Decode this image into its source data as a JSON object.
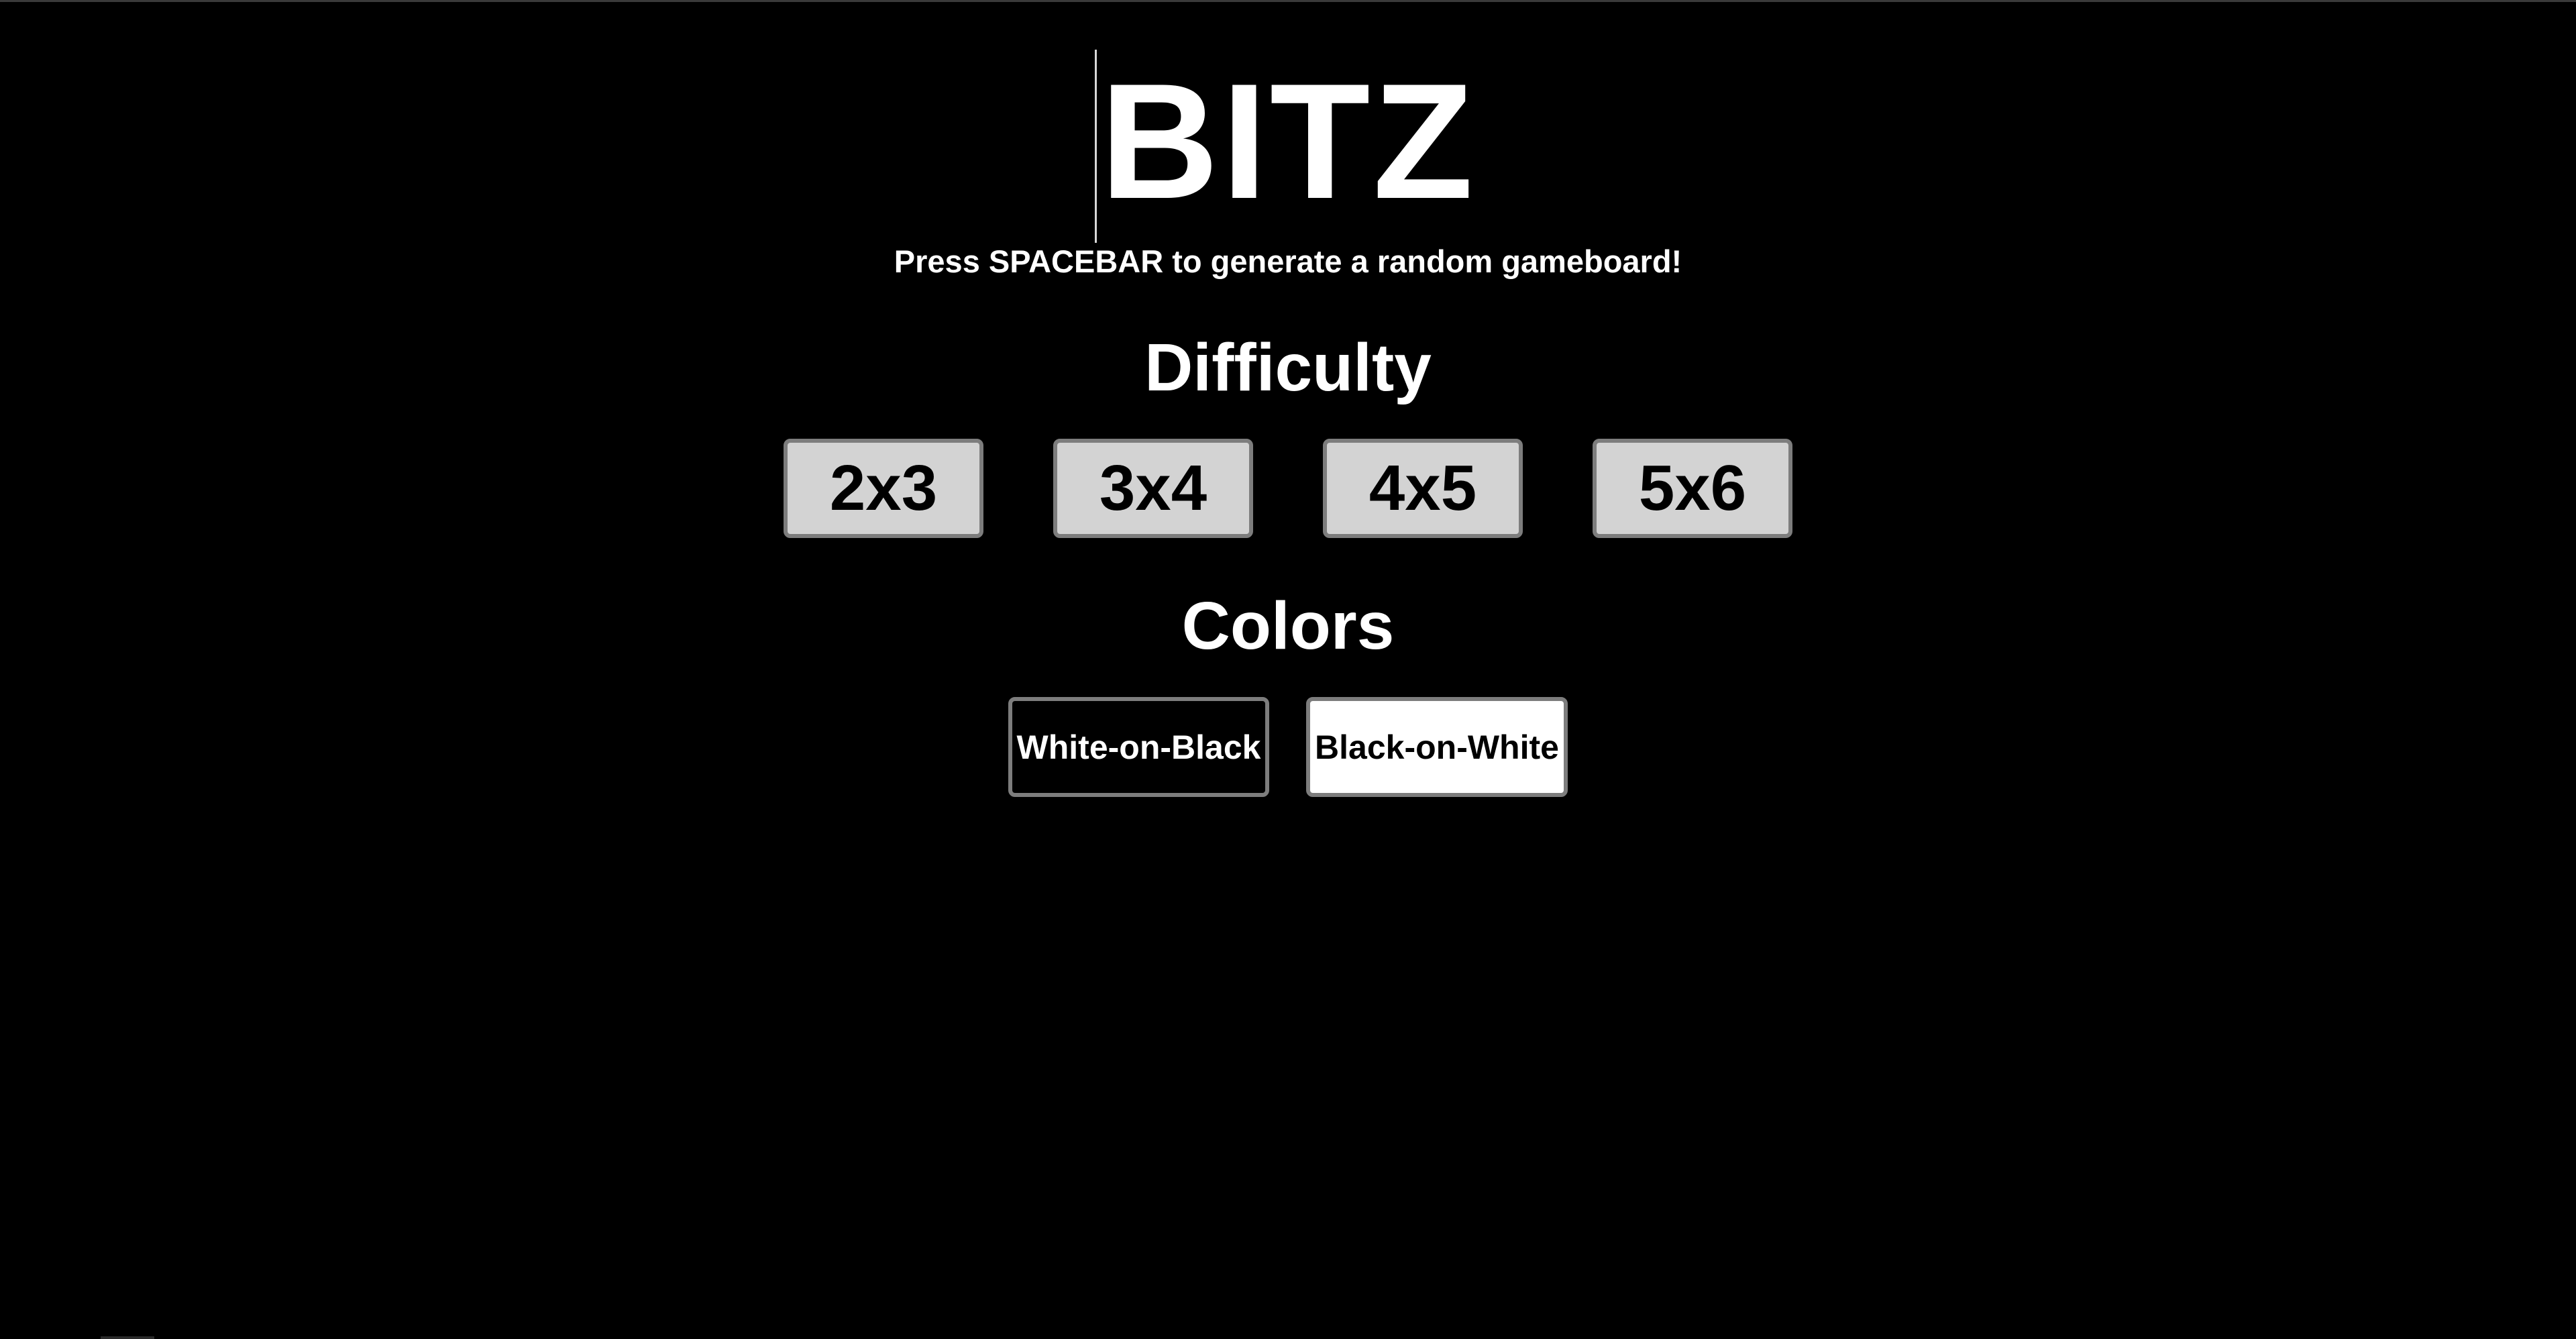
{
  "app": {
    "title": "BITZ",
    "subtitle": "Press SPACEBAR to generate a random gameboard!"
  },
  "difficulty": {
    "heading": "Difficulty",
    "options": [
      "2x3",
      "3x4",
      "4x5",
      "5x6"
    ]
  },
  "colors": {
    "heading": "Colors",
    "options": [
      {
        "label": "White-on-Black",
        "background": "#000000",
        "text": "#ffffff"
      },
      {
        "label": "Black-on-White",
        "background": "#ffffff",
        "text": "#000000"
      }
    ]
  },
  "theme": {
    "page_background": "#000000",
    "button_fill": "#d3d3d3",
    "button_border": "#7d7d7d"
  }
}
